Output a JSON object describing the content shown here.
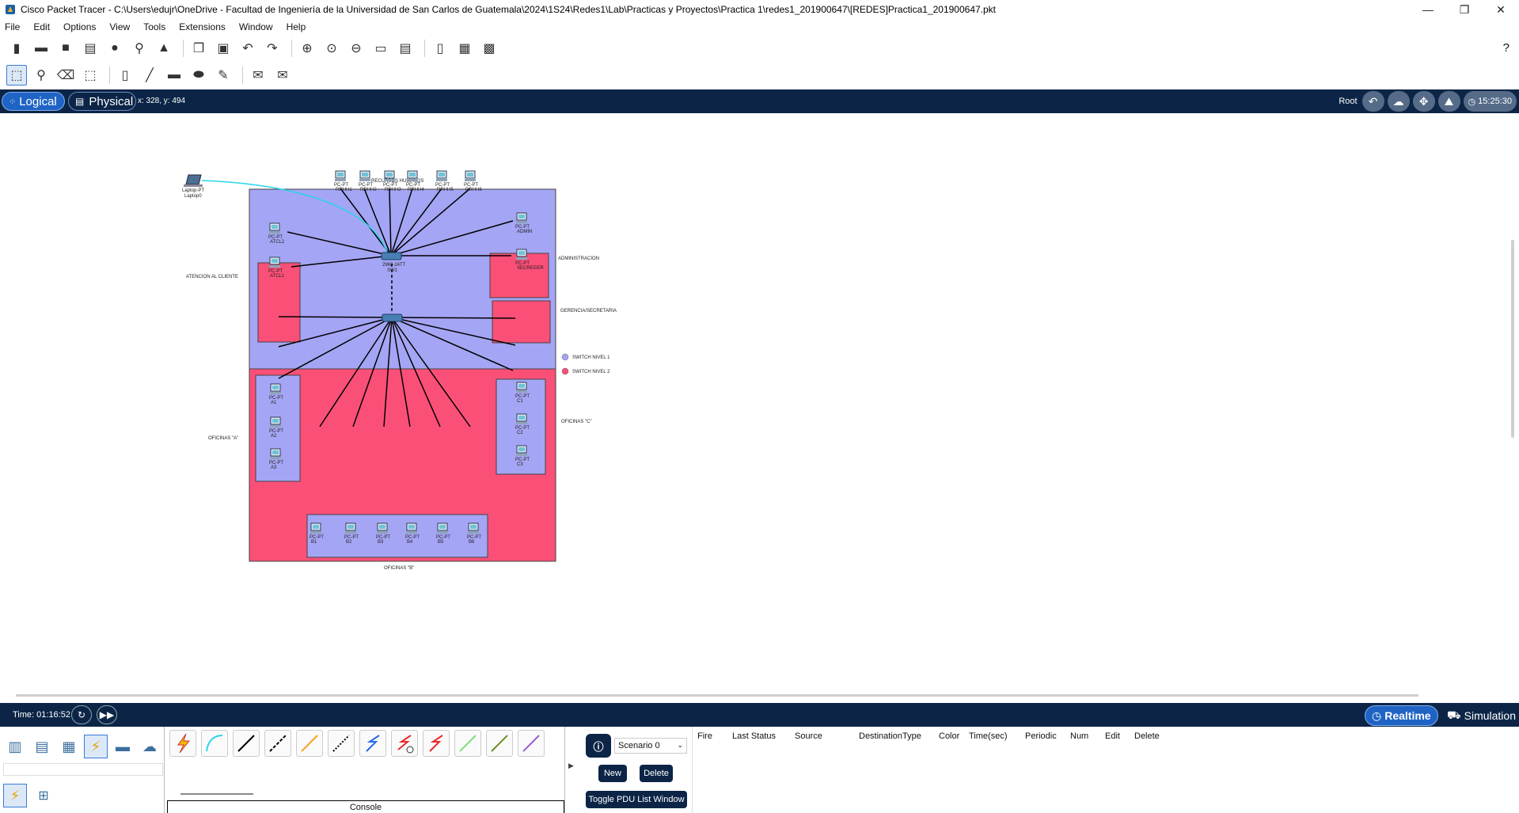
{
  "window": {
    "title": "Cisco Packet Tracer - C:\\Users\\edujr\\OneDrive - Facultad de Ingeniería de la Universidad de San Carlos de Guatemala\\2024\\1S24\\Redes1\\Lab\\Practicas y Proyectos\\Practica 1\\redes1_201900647\\[REDES]Practica1_201900647.pkt",
    "minimize": "—",
    "restore": "❐",
    "close": "✕"
  },
  "menu": [
    "File",
    "Edit",
    "Options",
    "View",
    "Tools",
    "Extensions",
    "Window",
    "Help"
  ],
  "help_icon": "?",
  "tabs": {
    "logical": "Logical",
    "physical": "Physical"
  },
  "coords": "x: 328, y: 494",
  "root_label": "Root",
  "clock": "15:25:30",
  "time_label": "Time: 01:16:52",
  "modes": {
    "realtime": "Realtime",
    "simulation": "Simulation"
  },
  "scenario": "Scenario 0",
  "pdu_buttons": {
    "new": "New",
    "delete": "Delete",
    "toggle": "Toggle PDU List Window"
  },
  "pdu_columns": [
    "Fire",
    "Last Status",
    "Source",
    "Destination",
    "Type",
    "Color",
    "Time(sec)",
    "Periodic",
    "Num",
    "Edit",
    "Delete"
  ],
  "console_label": "Console",
  "topology": {
    "areas": {
      "rrhh": "RECURSOS HUMANOS",
      "atencion": "ATENCION AL CLIENTE",
      "admin": "ADMINISTRACION",
      "gerencia": "GERENCIA/SECRETARIA",
      "ofa": "OFICINAS \"A\"",
      "ofb": "OFICINAS \"B\"",
      "ofc": "OFICINAS \"C\""
    },
    "legend": [
      {
        "label": "SWITCH NIVEL 1",
        "color": "#a5a5f5"
      },
      {
        "label": "SWITCH NIVEL 2",
        "color": "#fa5078"
      }
    ],
    "laptop": {
      "model": "Laptop-PT",
      "name": "Laptop0"
    },
    "switch1": {
      "model": "2960-24TT",
      "name": "SW1"
    },
    "rrhh_pcs": [
      "RRHH1",
      "RRHH2",
      "RRHH3",
      "RRHH4",
      "RRHH5",
      "RRHH6"
    ],
    "atc_pcs": [
      "ATCL2",
      "ATCL1"
    ],
    "admin_pc": "ADMIN",
    "gerencia_pc": "SECREGER",
    "a_pcs": [
      "A1",
      "A2",
      "A3"
    ],
    "b_pcs": [
      "B1",
      "B2",
      "B3",
      "B4",
      "B5",
      "B6"
    ],
    "c_pcs": [
      "C1",
      "C2",
      "C3"
    ],
    "pc_model": "PC-PT"
  }
}
